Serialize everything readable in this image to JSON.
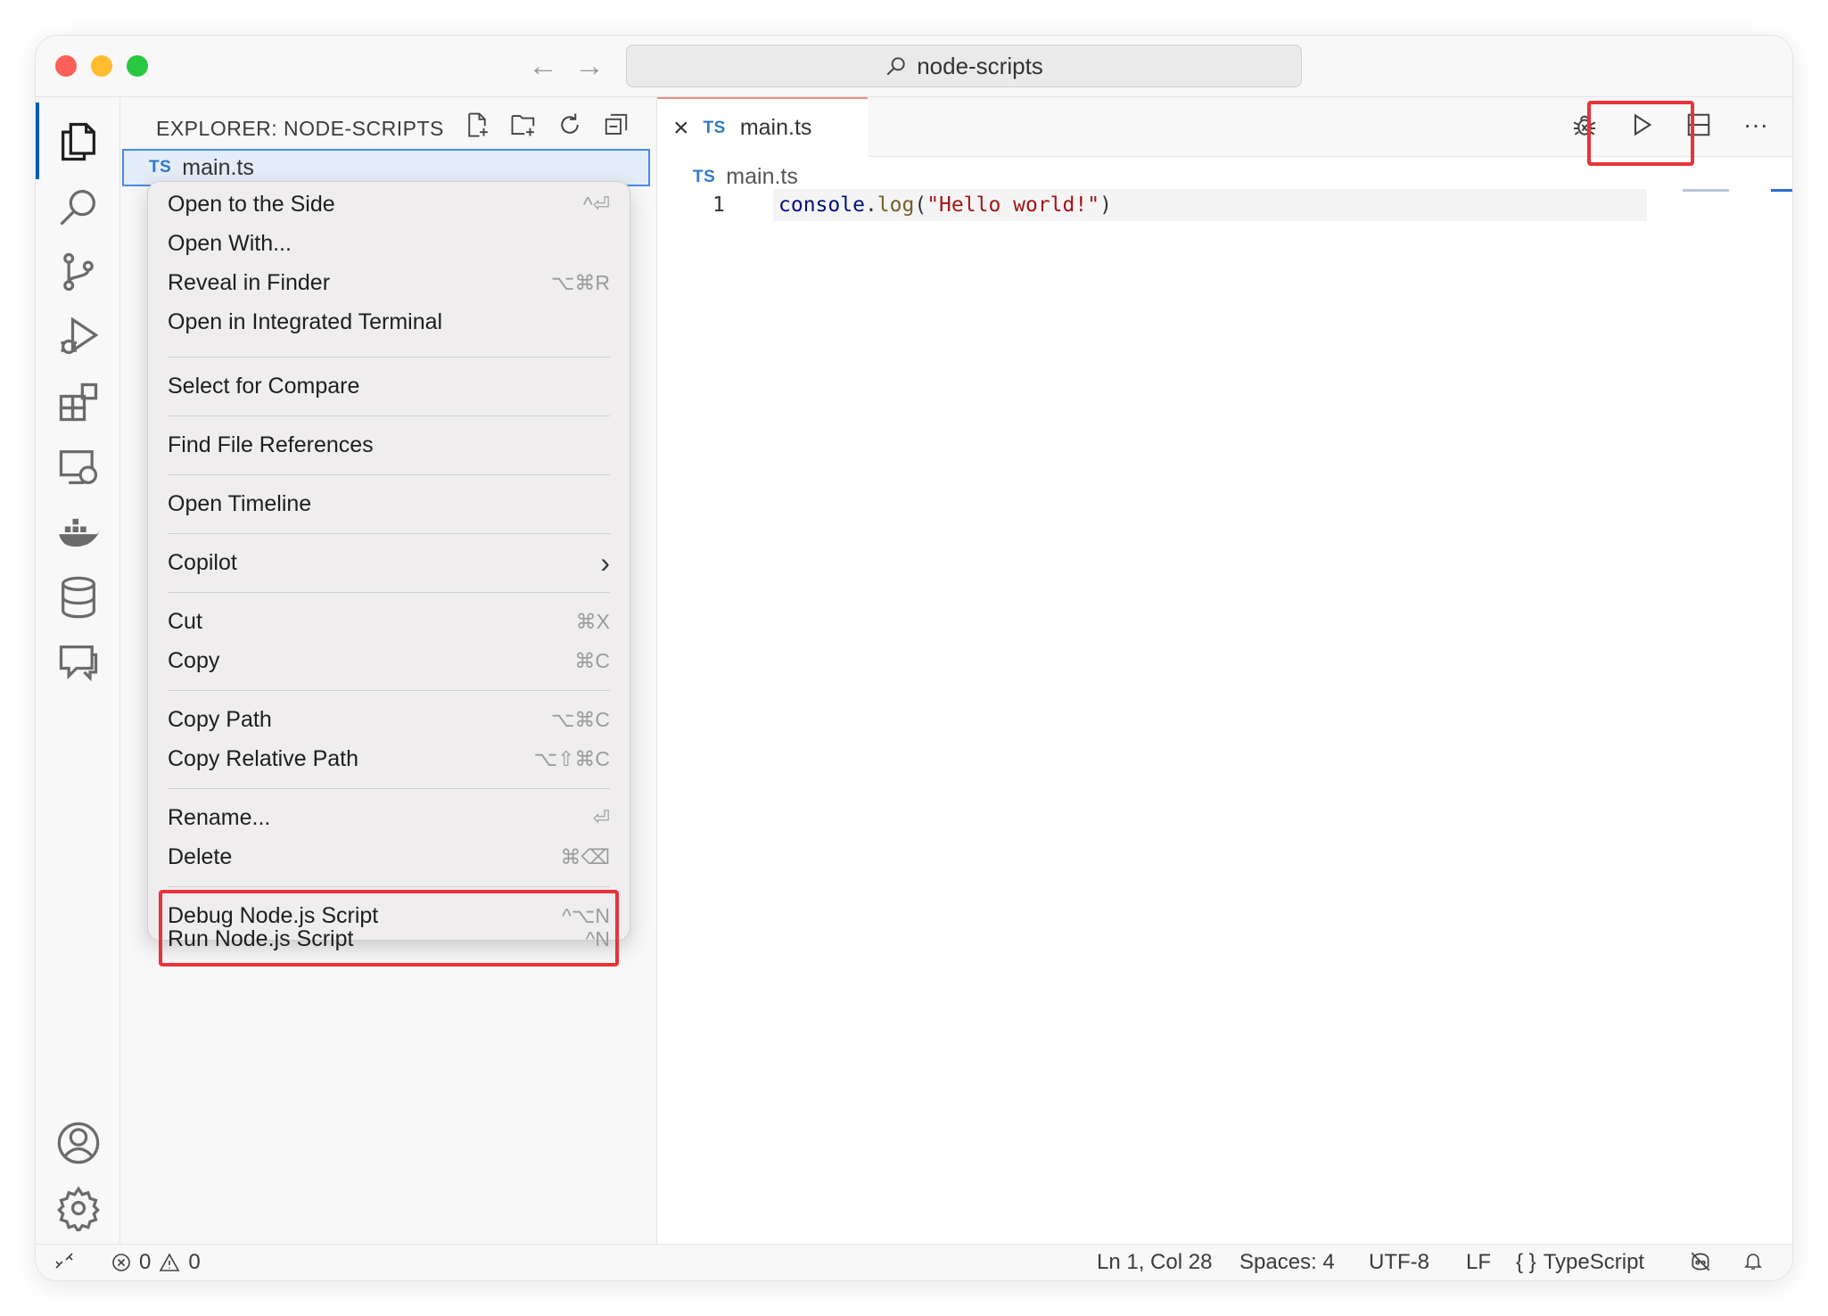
{
  "titlebar": {
    "search_text": "node-scripts",
    "back_glyph": "←",
    "forward_glyph": "→"
  },
  "activity_bar": {
    "items": [
      "explorer-icon",
      "search-icon",
      "source-control-icon",
      "run-debug-icon",
      "extensions-icon",
      "remote-explorer-icon",
      "docker-icon",
      "database-icon",
      "chat-icon"
    ],
    "bottom_items": [
      "account-icon",
      "settings-gear-icon"
    ]
  },
  "sidebar": {
    "title": "EXPLORER: NODE-SCRIPTS",
    "selected_file": {
      "badge": "TS",
      "name": "main.ts"
    }
  },
  "context_menu": {
    "groups": [
      [
        {
          "label": "Open to the Side",
          "shortcut": "^⏎"
        },
        {
          "label": "Open With...",
          "shortcut": ""
        },
        {
          "label": "Reveal in Finder",
          "shortcut": "⌥⌘R"
        },
        {
          "label": "Open in Integrated Terminal",
          "shortcut": ""
        }
      ],
      [
        {
          "label": "Select for Compare",
          "shortcut": ""
        }
      ],
      [
        {
          "label": "Find File References",
          "shortcut": ""
        }
      ],
      [
        {
          "label": "Open Timeline",
          "shortcut": ""
        }
      ],
      [
        {
          "label": "Copilot",
          "shortcut": "›"
        }
      ],
      [
        {
          "label": "Cut",
          "shortcut": "⌘X"
        },
        {
          "label": "Copy",
          "shortcut": "⌘C"
        }
      ],
      [
        {
          "label": "Copy Path",
          "shortcut": "⌥⌘C"
        },
        {
          "label": "Copy Relative Path",
          "shortcut": "⌥⇧⌘C"
        }
      ],
      [
        {
          "label": "Rename...",
          "shortcut": "⏎"
        },
        {
          "label": "Delete",
          "shortcut": "⌘⌫"
        }
      ],
      [
        {
          "label": "Debug Node.js Script",
          "shortcut": "^⌥N"
        },
        {
          "label": "Run Node.js Script",
          "shortcut": "^N"
        }
      ]
    ]
  },
  "editor": {
    "tab": {
      "close_glyph": "×",
      "badge": "TS",
      "name": "main.ts"
    },
    "breadcrumb": {
      "badge": "TS",
      "name": "main.ts"
    },
    "line_number": "1",
    "code": {
      "obj": "console",
      "dot": ".",
      "fn": "log",
      "open": "(",
      "str": "\"Hello world!\"",
      "close": ")"
    },
    "more_glyph": "···"
  },
  "status_bar": {
    "errors": "0",
    "warnings": "0",
    "position": "Ln 1, Col 28",
    "spaces": "Spaces: 4",
    "encoding": "UTF-8",
    "eol": "LF",
    "language_glyph": "{ }",
    "language": "TypeScript"
  },
  "colors": {
    "highlight": "#e8333a",
    "accent": "#005fb8",
    "ts": "#3178c6"
  }
}
